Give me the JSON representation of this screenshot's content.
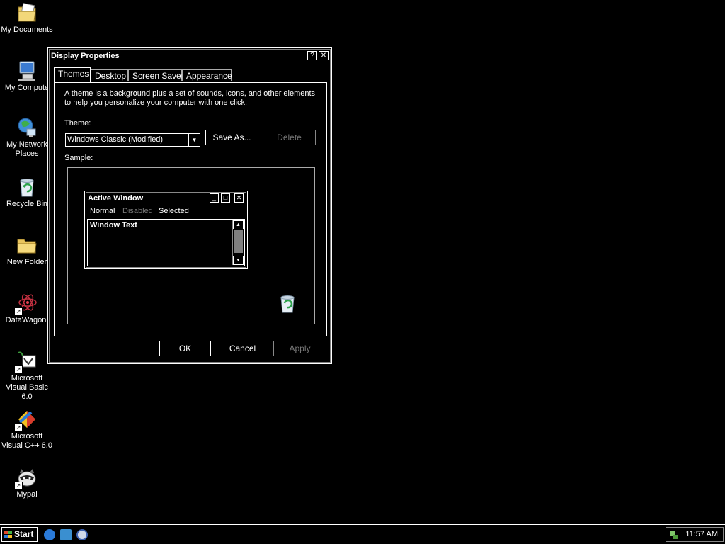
{
  "desktop_icons": [
    {
      "label": "My Documents",
      "icon": "my-documents-icon"
    },
    {
      "label": "My Compute",
      "icon": "my-computer-icon"
    },
    {
      "label": "My Network Places",
      "icon": "network-places-icon"
    },
    {
      "label": "Recycle Bin",
      "icon": "recycle-bin-icon"
    },
    {
      "label": "New Folder",
      "icon": "folder-icon"
    },
    {
      "label": "DataWagon.",
      "icon": "datawagon-icon"
    },
    {
      "label": "Microsoft Visual Basic 6.0",
      "icon": "visual-basic-icon"
    },
    {
      "label": "Microsoft Visual C++ 6.0",
      "icon": "visual-cpp-icon"
    },
    {
      "label": "Mypal",
      "icon": "mypal-icon"
    }
  ],
  "dialog": {
    "title": "Display Properties",
    "help_btn": "?",
    "close_btn": "✕",
    "tabs": [
      "Themes",
      "Desktop",
      "Screen Saver",
      "Appearance"
    ],
    "active_tab": "Themes",
    "description": "A theme is a background plus a set of sounds, icons, and other elements to help you personalize your computer with one click.",
    "theme_label": "Theme:",
    "theme_value": "Windows Classic (Modified)",
    "save_as": "Save As...",
    "delete": "Delete",
    "sample_label": "Sample:",
    "sample": {
      "window_title": "Active Window",
      "menu_normal": "Normal",
      "menu_disabled": "Disabled",
      "menu_selected": "Selected",
      "window_text": "Window Text"
    },
    "ok": "OK",
    "cancel": "Cancel",
    "apply": "Apply"
  },
  "taskbar": {
    "start": "Start",
    "quick_launch": [
      "internet-explorer-icon",
      "outlook-express-icon",
      "media-player-icon"
    ],
    "clock": "11:57 AM"
  }
}
